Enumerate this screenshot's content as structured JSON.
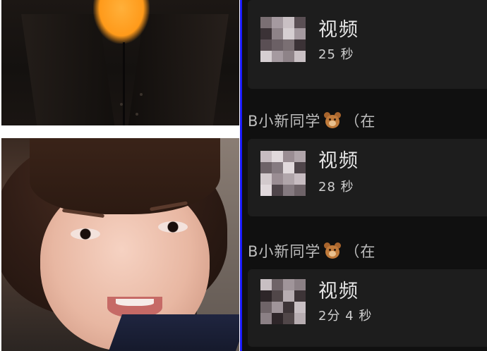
{
  "divider_color": "#1a1aff",
  "chat": {
    "messages": [
      {
        "label": "视频",
        "duration": "25 秒"
      },
      {
        "sender": "B小新同学",
        "sender_icon": "bear-emoji-icon",
        "sender_suffix": "（在",
        "label": "视频",
        "duration": "28 秒"
      },
      {
        "sender": "B小新同学",
        "sender_icon": "bear-emoji-icon",
        "sender_suffix": "（在",
        "label": "视频",
        "duration": "2分 4 秒"
      }
    ]
  }
}
